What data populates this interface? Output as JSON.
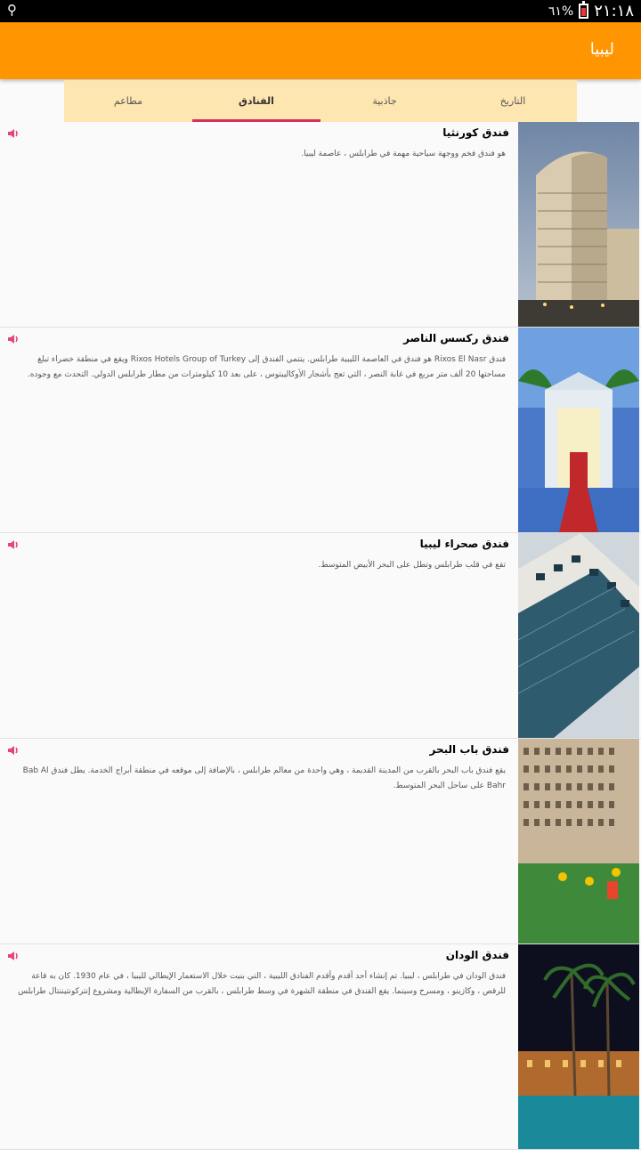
{
  "status_bar": {
    "usb_icon": "usb-icon",
    "battery_percent": "٦١%",
    "clock": "٢١:١٨"
  },
  "app_bar": {
    "title": "ليبيا"
  },
  "tabs": [
    {
      "label": "التاريخ",
      "active": false
    },
    {
      "label": "جاذبية",
      "active": false
    },
    {
      "label": "الفنادق",
      "active": true
    },
    {
      "label": "مطاعم",
      "active": false
    }
  ],
  "accent_color": "#d62f5c",
  "items": [
    {
      "title": "فندق كورنثيا",
      "description": "هو فندق فخم ووجهة سياحية مهمة في طرابلس ، عاصمة ليبيا.",
      "image_icon": "hotel-photo"
    },
    {
      "title": "فندق ركسس الناصر",
      "description": "فندق Rixos El Nasr هو فندق في العاصمة الليبية طرابلس. ينتمي الفندق إلى Rixos Hotels Group of Turkey ويقع في منطقة خضراء تبلغ مساحتها 20 ألف متر مربع في غابة النصر ، التي تعج بأشجار الأوكاليبتوس ، على بعد 10 كيلومترات من مطار طرابلس الدولي. التحدث مع وجوده.",
      "image_icon": "hotel-photo"
    },
    {
      "title": "فندق صحراء ليبيا",
      "description": "تقع في قلب طرابلس وتطل على البحر الأبيض المتوسط.",
      "image_icon": "hotel-photo"
    },
    {
      "title": "فندق باب البحر",
      "description": "يقع فندق باب البحر بالقرب من المدينة القديمة ، وهي واحدة من معالم طرابلس ، بالإضافة إلى موقعه في منطقة أبراج الخدمة. يطل فندق Bab Al Bahr على ساحل البحر المتوسط.",
      "image_icon": "hotel-photo"
    },
    {
      "title": "فندق الودان",
      "description": "فندق الودان في طرابلس ، ليبيا. تم إنشاء أحد أقدم وأقدم الفنادق الليبية ، التي بنيت خلال الاستعمار الإيطالي لليبيا ، في عام 1930. كان به قاعة للرقص ، وكازينو ، ومسرح وسينما. يقع الفندق في منطقة الشهرة في وسط طرابلس ، بالقرب من السفارة الإيطالية ومشروع إنتركونتيننتال طرابلس",
      "image_icon": "hotel-photo"
    }
  ]
}
